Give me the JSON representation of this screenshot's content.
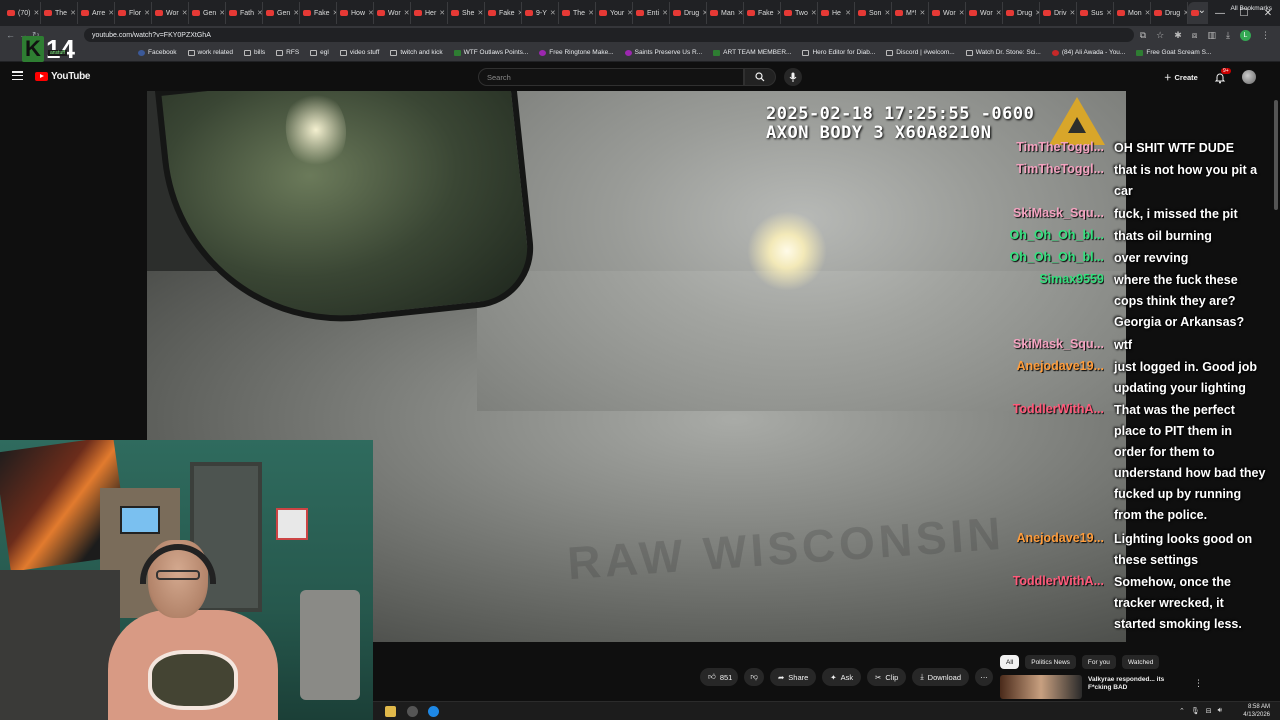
{
  "browser": {
    "tabs": [
      "(70)",
      "The",
      "Arre",
      "Flor",
      "Wor",
      "Gen",
      "Fath",
      "Gen",
      "Fake",
      "How",
      "Wor",
      "Her",
      "She",
      "Fake",
      "9-Y",
      "The",
      "Your",
      "Enti",
      "Drug",
      "Man",
      "Fake",
      "Two",
      "He",
      "Son",
      "M*!",
      "Wor",
      "Wor",
      "Drug",
      "Driv",
      "Sus",
      "Mon",
      "Drug",
      ""
    ],
    "new_tab_label": "+",
    "address": "youtube.com/watch?v=FKY0PZXtGhA",
    "bookmarks": [
      "Facebook",
      "work related",
      "bills",
      "RFS",
      "egl",
      "video stuff",
      "twitch and kick",
      "WTF Outlaws Points...",
      "Free Ringtone Make...",
      "Saints Preserve Us R...",
      "ART TEAM MEMBER...",
      "Hero Editor for Diab...",
      "Discord | #welcom...",
      "Watch Dr. Stone: Sci...",
      "(84) Ali Awada - You...",
      "Free Goat Scream S..."
    ],
    "all_bookmarks": "All Bookmarks",
    "profile_initial": "L"
  },
  "overlay_logo": {
    "letter": "K",
    "number": "14",
    "sub": "anstuff"
  },
  "youtube": {
    "logo_text": "YouTube",
    "search_placeholder": "Search",
    "create_label": "Create",
    "notif_badge": "9+"
  },
  "video": {
    "timestamp": "2025-02-18 17:25:55 -0600",
    "camera_id": "AXON BODY 3 X60A8210N",
    "watermark": "RAW WISCONSIN"
  },
  "chat": [
    {
      "user": "TimTheToggl...",
      "color": "#f4a3c0",
      "lines": [
        "OH SHIT WTF DUDE"
      ]
    },
    {
      "user": "TimTheToggl...",
      "color": "#f4a3c0",
      "lines": [
        "that is not how you pit a",
        "car"
      ]
    },
    {
      "user": "SkiMask_Squ...",
      "color": "#f4a3c0",
      "lines": [
        "fuck, i missed the pit"
      ]
    },
    {
      "user": "Oh_Oh_Oh_bl...",
      "color": "#36e07f",
      "lines": [
        "thats oil burning"
      ]
    },
    {
      "user": "Oh_Oh_Oh_bl...",
      "color": "#36e07f",
      "lines": [
        "over revving"
      ]
    },
    {
      "user": "Simax9559",
      "color": "#36e07f",
      "lines": [
        "where the fuck these",
        "cops think they are?",
        "Georgia or Arkansas?"
      ]
    },
    {
      "user": "SkiMask_Squ...",
      "color": "#f4a3c0",
      "lines": [
        "wtf"
      ]
    },
    {
      "user": "Anejodave19...",
      "color": "#ff9d3c",
      "lines": [
        "just logged in. Good job",
        "updating your lighting"
      ]
    },
    {
      "user": "ToddlerWithA...",
      "color": "#ff5a7a",
      "lines": [
        "That was the perfect",
        "place to PIT them in",
        "order for them to",
        "understand how bad they",
        "fucked up by running",
        "from the police."
      ]
    },
    {
      "user": "Anejodave19...",
      "color": "#ff9d3c",
      "lines": [
        "Lighting looks good on",
        "these settings"
      ]
    },
    {
      "user": "ToddlerWithA...",
      "color": "#ff5a7a",
      "lines": [
        "Somehow, once the",
        "tracker wrecked, it",
        "started smoking less."
      ]
    }
  ],
  "actions": {
    "like_count": "851",
    "share": "Share",
    "ask": "Ask",
    "clip": "Clip",
    "download": "Download"
  },
  "filters": [
    "All",
    "Politics News",
    "For you",
    "Watched"
  ],
  "recommendation": {
    "title": "Valkyrae responded... its F*cking BAD"
  },
  "taskbar": {
    "time": "8:58 AM",
    "date": "4/13/2026"
  }
}
